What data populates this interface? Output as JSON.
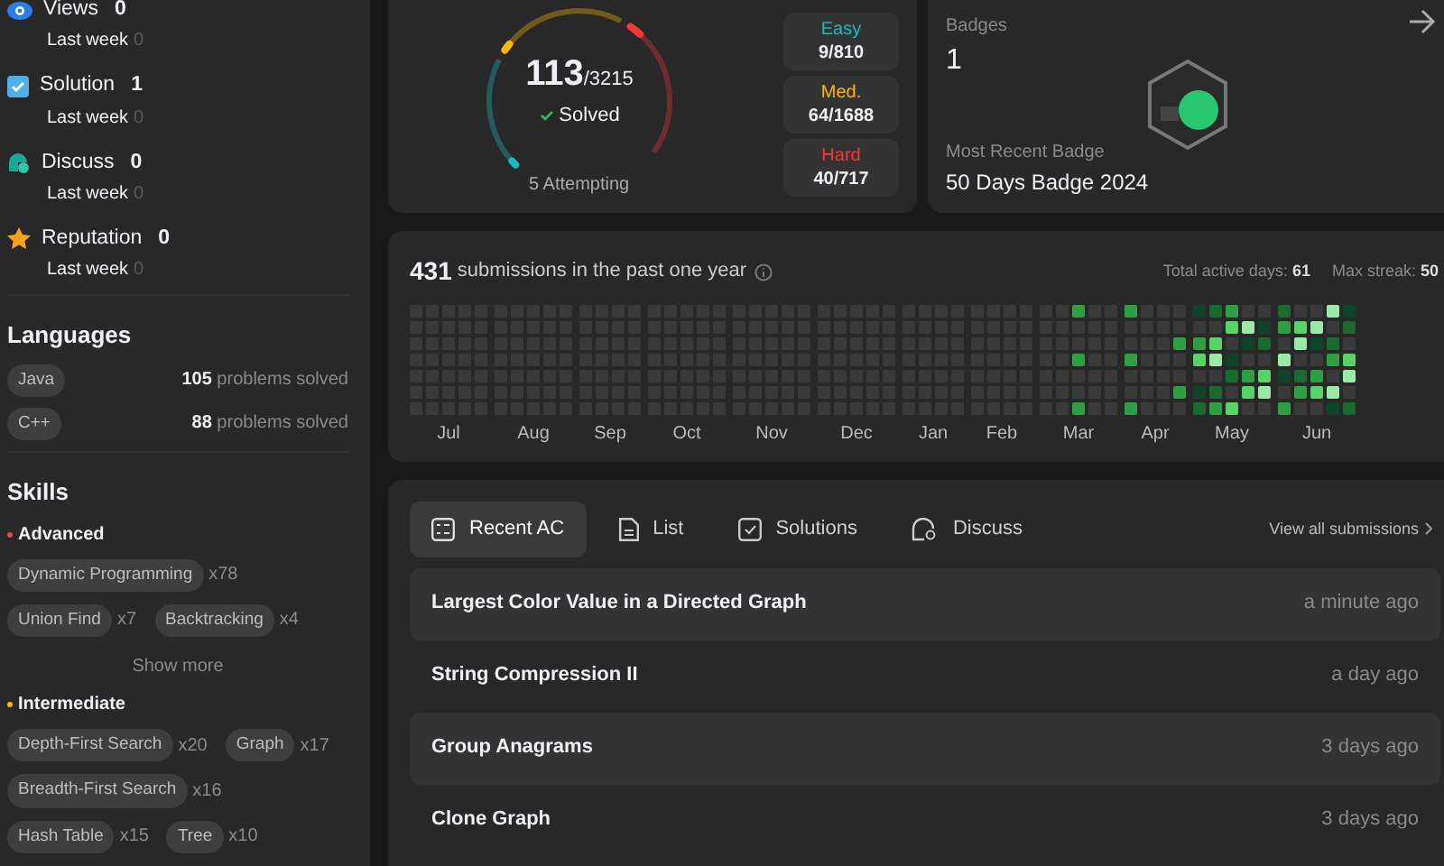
{
  "sidebar": {
    "community_stats": [
      {
        "kind": "views",
        "label": "Views",
        "value": "0",
        "sub_label": "Last week",
        "sub_value": "0"
      },
      {
        "kind": "solution",
        "label": "Solution",
        "value": "1",
        "sub_label": "Last week",
        "sub_value": "0"
      },
      {
        "kind": "discuss",
        "label": "Discuss",
        "value": "0",
        "sub_label": "Last week",
        "sub_value": "0"
      },
      {
        "kind": "reputation",
        "label": "Reputation",
        "value": "0",
        "sub_label": "Last week",
        "sub_value": "0"
      }
    ],
    "languages": {
      "title": "Languages",
      "items": [
        {
          "name": "Java",
          "count": "105",
          "suffix": "problems solved"
        },
        {
          "name": "C++",
          "count": "88",
          "suffix": "problems solved"
        }
      ]
    },
    "skills": {
      "title": "Skills",
      "groups": [
        {
          "name": "Advanced",
          "color": "#ef4743",
          "tags": [
            {
              "name": "Dynamic Programming",
              "count": "x78"
            },
            {
              "name": "Union Find",
              "count": "x7"
            },
            {
              "name": "Backtracking",
              "count": "x4"
            }
          ],
          "more": "Show more"
        },
        {
          "name": "Intermediate",
          "color": "#ffb800",
          "tags": [
            {
              "name": "Depth-First Search",
              "count": "x20"
            },
            {
              "name": "Graph",
              "count": "x17"
            },
            {
              "name": "Breadth-First Search",
              "count": "x16"
            },
            {
              "name": "Hash Table",
              "count": "x15"
            },
            {
              "name": "Tree",
              "count": "x10"
            }
          ]
        }
      ]
    }
  },
  "progress": {
    "solved": "113",
    "total": "/3215",
    "solved_label": "Solved",
    "attempting": "5 Attempting",
    "difficulties": [
      {
        "label": "Easy",
        "value": "9/810",
        "color": "#1cbaba",
        "level": 0.011
      },
      {
        "label": "Med.",
        "value": "64/1688",
        "color": "#ffb700",
        "level": 0.038
      },
      {
        "label": "Hard",
        "value": "40/717",
        "color": "#f63737",
        "level": 0.056
      }
    ]
  },
  "badges": {
    "title": "Badges",
    "count": "1",
    "recent_label": "Most Recent Badge",
    "recent_name": "50 Days Badge 2024"
  },
  "submissions": {
    "count": "431",
    "text": "submissions in the past one year",
    "active_label": "Total active days:",
    "active_value": "61",
    "streak_label": "Max streak:",
    "streak_value": "50",
    "months": [
      "Jul",
      "Aug",
      "Sep",
      "Oct",
      "Nov",
      "Dec",
      "Jan",
      "Feb",
      "Mar",
      "Apr",
      "May",
      "Jun"
    ]
  },
  "recent": {
    "tabs": [
      {
        "kind": "recent",
        "label": "Recent AC",
        "selected": true
      },
      {
        "kind": "list",
        "label": "List",
        "selected": false
      },
      {
        "kind": "solutions",
        "label": "Solutions",
        "selected": false
      },
      {
        "kind": "discuss",
        "label": "Discuss",
        "selected": false
      }
    ],
    "view_all": "View all submissions",
    "rows": [
      {
        "title": "Largest Color Value in a Directed Graph",
        "time": "a minute ago"
      },
      {
        "title": "String Compression II",
        "time": "a day ago"
      },
      {
        "title": "Group Anagrams",
        "time": "3 days ago"
      },
      {
        "title": "Clone Graph",
        "time": "3 days ago"
      }
    ]
  }
}
